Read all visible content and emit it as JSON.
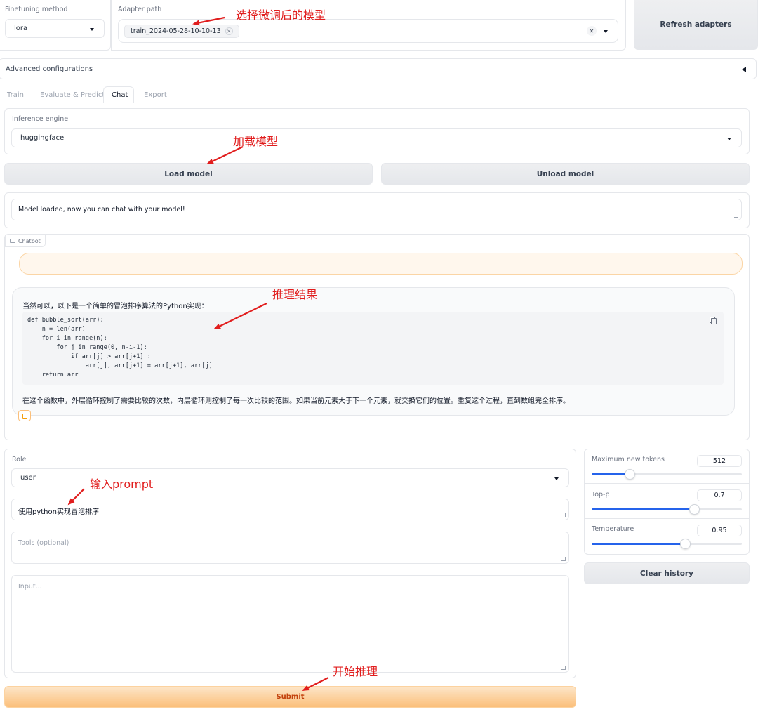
{
  "top": {
    "finetuning_label": "Finetuning method",
    "finetuning_value": "lora",
    "adapter_label": "Adapter path",
    "adapter_tag": "train_2024-05-28-10-10-13",
    "refresh_label": "Refresh adapters"
  },
  "advanced_label": "Advanced configurations",
  "tabs": [
    "Train",
    "Evaluate & Predict",
    "Chat",
    "Export"
  ],
  "engine": {
    "label": "Inference engine",
    "value": "huggingface"
  },
  "buttons": {
    "load": "Load model",
    "unload": "Unload model",
    "clear": "Clear history",
    "submit": "Submit"
  },
  "status_text": "Model loaded, now you can chat with your model!",
  "chatbot": {
    "label": "Chatbot",
    "reply_intro": "当然可以，以下是一个简单的冒泡排序算法的Python实现：",
    "code_lines": [
      "def bubble_sort(arr):",
      "    n = len(arr)",
      "    for i in range(n):",
      "        for j in range(0, n-i-1):",
      "            if arr[j] > arr[j+1] :",
      "                arr[j], arr[j+1] = arr[j+1], arr[j]",
      "    return arr"
    ],
    "reply_outro": "在这个函数中，外层循环控制了需要比较的次数，内层循环则控制了每一次比较的范围。如果当前元素大于下一个元素，就交换它们的位置。重复这个过程，直到数组完全排序。"
  },
  "role": {
    "label": "Role",
    "value": "user"
  },
  "prompt_value": "使用python实现冒泡排序",
  "tools_placeholder": "Tools (optional)",
  "input_placeholder": "Input...",
  "params": {
    "max_tokens": {
      "label": "Maximum new tokens",
      "value": "512",
      "fraction": 0.25
    },
    "top_p": {
      "label": "Top-p",
      "value": "0.7",
      "fraction": 0.68
    },
    "temperature": {
      "label": "Temperature",
      "value": "0.95",
      "fraction": 0.62
    }
  },
  "annotations": {
    "select_model": "选择微调后的模型",
    "load_model": "加载模型",
    "result": "推理结果",
    "input_prompt": "输入prompt",
    "start": "开始推理"
  },
  "colors": {
    "accent": "#2563eb",
    "submit_from": "#fde6c8",
    "submit_to": "#fbbf7a",
    "annotation": "#e11d1d",
    "submit_text": "#c2410c"
  }
}
